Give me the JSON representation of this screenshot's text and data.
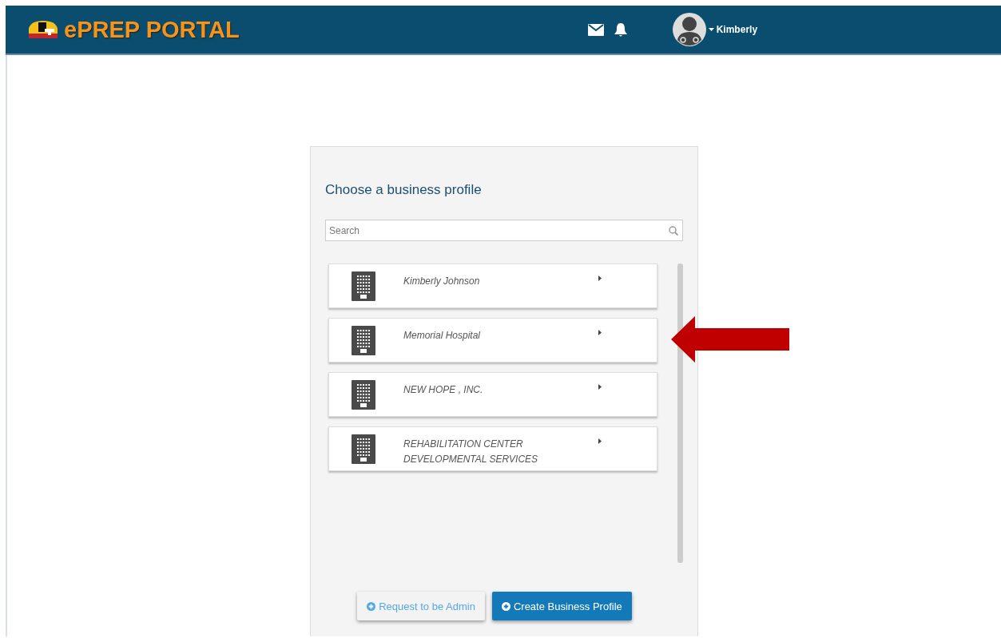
{
  "header": {
    "logo_text": "ePREP PORTAL",
    "user_name": "Kimberly"
  },
  "card": {
    "title": "Choose a business profile",
    "search": {
      "placeholder": "Search"
    },
    "profiles": [
      {
        "name": "Kimberly Johnson"
      },
      {
        "name": "Memorial Hospital"
      },
      {
        "name": "NEW HOPE , INC."
      },
      {
        "name": "REHABILITATION CENTER DEVELOPMENTAL SERVICES"
      }
    ],
    "buttons": [
      {
        "label": "Request to be Admin",
        "kind": "secondary"
      },
      {
        "label": "Create Business Profile",
        "kind": "primary"
      }
    ]
  },
  "annotation": {
    "kind": "arrow"
  }
}
